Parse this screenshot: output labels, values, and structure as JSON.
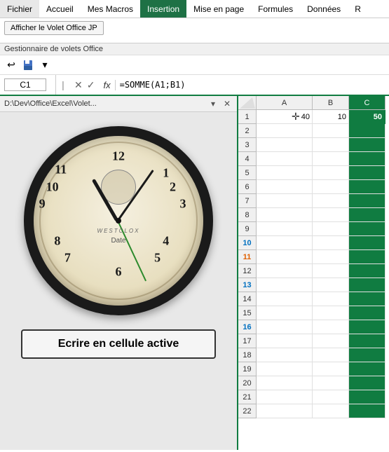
{
  "menubar": {
    "items": [
      {
        "label": "Fichier",
        "active": false
      },
      {
        "label": "Accueil",
        "active": false
      },
      {
        "label": "Mes Macros",
        "active": false
      },
      {
        "label": "Insertion",
        "active": true
      },
      {
        "label": "Mise en page",
        "active": false
      },
      {
        "label": "Formules",
        "active": false
      },
      {
        "label": "Données",
        "active": false
      },
      {
        "label": "R",
        "active": false
      }
    ]
  },
  "ribbon": {
    "button_label": "Afficher le Volet Office JP"
  },
  "gestionnaire": {
    "label": "Gestionnaire de volets Office"
  },
  "formulabar": {
    "cell_ref": "C1",
    "formula": "=SOMME(A1;B1)",
    "fx_label": "fx"
  },
  "panel": {
    "title": "D:\\Dev\\Office\\Excel\\Volet...",
    "dropdown_symbol": "▾",
    "close_symbol": "✕",
    "brand": "WESTCLOX",
    "date_label": "Date",
    "button_label": "Ecrire en cellule active"
  },
  "spreadsheet": {
    "col_headers": [
      "A",
      "B",
      "C"
    ],
    "rows": [
      {
        "num": "1",
        "a": "40",
        "b": "10",
        "c": "50",
        "style": "normal"
      },
      {
        "num": "2",
        "a": "",
        "b": "",
        "c": "",
        "style": "normal"
      },
      {
        "num": "3",
        "a": "",
        "b": "",
        "c": "",
        "style": "normal"
      },
      {
        "num": "4",
        "a": "",
        "b": "",
        "c": "",
        "style": "normal"
      },
      {
        "num": "5",
        "a": "",
        "b": "",
        "c": "",
        "style": "normal"
      },
      {
        "num": "6",
        "a": "",
        "b": "",
        "c": "",
        "style": "normal"
      },
      {
        "num": "7",
        "a": "",
        "b": "",
        "c": "",
        "style": "normal"
      },
      {
        "num": "8",
        "a": "",
        "b": "",
        "c": "",
        "style": "normal"
      },
      {
        "num": "9",
        "a": "",
        "b": "",
        "c": "",
        "style": "normal"
      },
      {
        "num": "10",
        "a": "",
        "b": "",
        "c": "",
        "style": "blue"
      },
      {
        "num": "11",
        "a": "",
        "b": "",
        "c": "",
        "style": "orange"
      },
      {
        "num": "12",
        "a": "",
        "b": "",
        "c": "",
        "style": "normal"
      },
      {
        "num": "13",
        "a": "",
        "b": "",
        "c": "",
        "style": "blue"
      },
      {
        "num": "14",
        "a": "",
        "b": "",
        "c": "",
        "style": "normal"
      },
      {
        "num": "15",
        "a": "",
        "b": "",
        "c": "",
        "style": "normal"
      },
      {
        "num": "16",
        "a": "",
        "b": "",
        "c": "",
        "style": "blue"
      },
      {
        "num": "17",
        "a": "",
        "b": "",
        "c": "",
        "style": "normal"
      },
      {
        "num": "18",
        "a": "",
        "b": "",
        "c": "",
        "style": "normal"
      },
      {
        "num": "19",
        "a": "",
        "b": "",
        "c": "",
        "style": "normal"
      },
      {
        "num": "20",
        "a": "",
        "b": "",
        "c": "",
        "style": "normal"
      },
      {
        "num": "21",
        "a": "",
        "b": "",
        "c": "",
        "style": "normal"
      },
      {
        "num": "22",
        "a": "",
        "b": "",
        "c": "",
        "style": "normal"
      }
    ]
  }
}
